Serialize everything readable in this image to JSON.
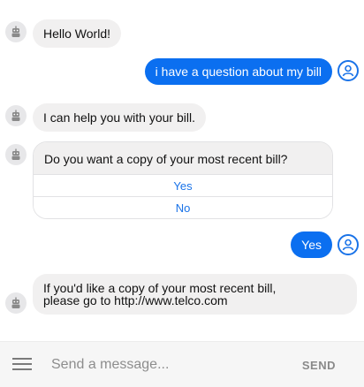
{
  "messages": {
    "m1": "Hello World!",
    "m2": "i have a question about my bill",
    "m3": "I can help you with your bill.",
    "m4": "Do you want a copy of your most recent bill?",
    "m4_options": [
      "Yes",
      "No"
    ],
    "m5": "Yes",
    "m6_line1": "If you'd like a copy of your most recent bill,",
    "m6_line2": "please go to http://www.telco.com"
  },
  "composer": {
    "placeholder": "Send a message...",
    "send_label": "SEND"
  },
  "colors": {
    "user_bubble": "#0b6ff0",
    "bot_bubble": "#f1f0f0",
    "link_blue": "#1a73e8"
  },
  "icons": {
    "bot": "robot-icon",
    "user": "user-icon",
    "menu": "menu-icon"
  }
}
